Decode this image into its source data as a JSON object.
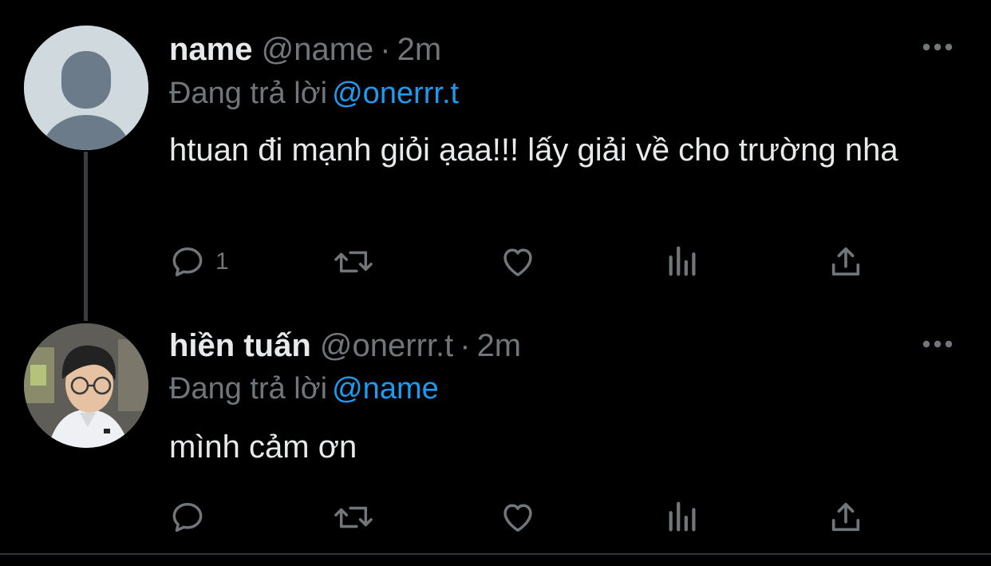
{
  "tweets": [
    {
      "display_name": "name",
      "handle": "@name",
      "separator": "·",
      "time": "2m",
      "reply_prefix": "Đang trả lời",
      "reply_to": "@onerrr.t",
      "text": "htuan đi mạnh giỏi ạaa!!! lấy giải về cho trường nha",
      "reply_count": "1",
      "avatar": "default-avatar-icon"
    },
    {
      "display_name": "hiền tuấn",
      "handle": "@onerrr.t",
      "separator": "·",
      "time": "2m",
      "reply_prefix": "Đang trả lời",
      "reply_to": "@name",
      "text": "mình cảm ơn",
      "reply_count": "",
      "avatar": "profile-photo"
    }
  ],
  "colors": {
    "background": "#000000",
    "text_primary": "#e7e9ea",
    "text_secondary": "#71767b",
    "accent": "#1d9bf0",
    "thread_line": "#3a3d40"
  },
  "icons": [
    "reply-icon",
    "retweet-icon",
    "like-icon",
    "views-icon",
    "share-icon",
    "more-icon"
  ]
}
